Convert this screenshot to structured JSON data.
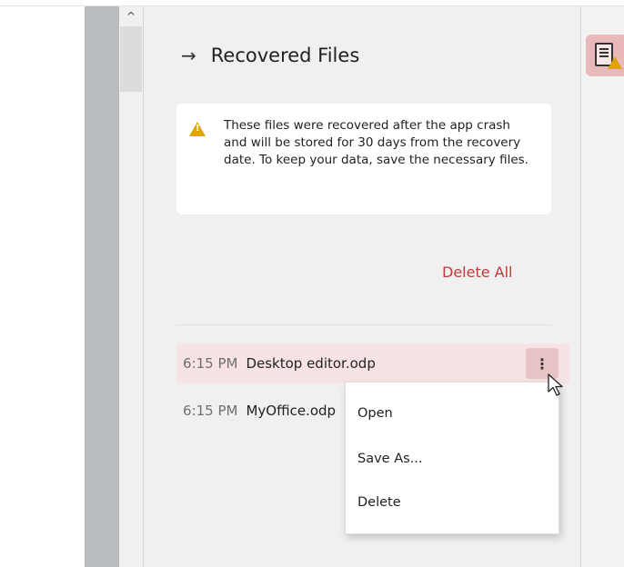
{
  "scrollbar": {
    "up_glyph": "^"
  },
  "panel": {
    "title": "Recovered Files",
    "header_icon": "arrow-right-icon",
    "notice": "These files were recovered after the app crash and will be stored for 30 days from the recovery date. To keep your data, save the necessary files.",
    "delete_all_label": "Delete All",
    "files": [
      {
        "time": "6:15 PM",
        "name": "Desktop editor.odp"
      },
      {
        "time": "6:15 PM",
        "name": "MyOffice.odp"
      }
    ]
  },
  "context_menu": {
    "items": [
      "Open",
      "Save As...",
      "Delete"
    ]
  },
  "colors": {
    "accent_red": "#c2393c",
    "warning": "#e2a400",
    "row_highlight": "#f7e3e4"
  }
}
